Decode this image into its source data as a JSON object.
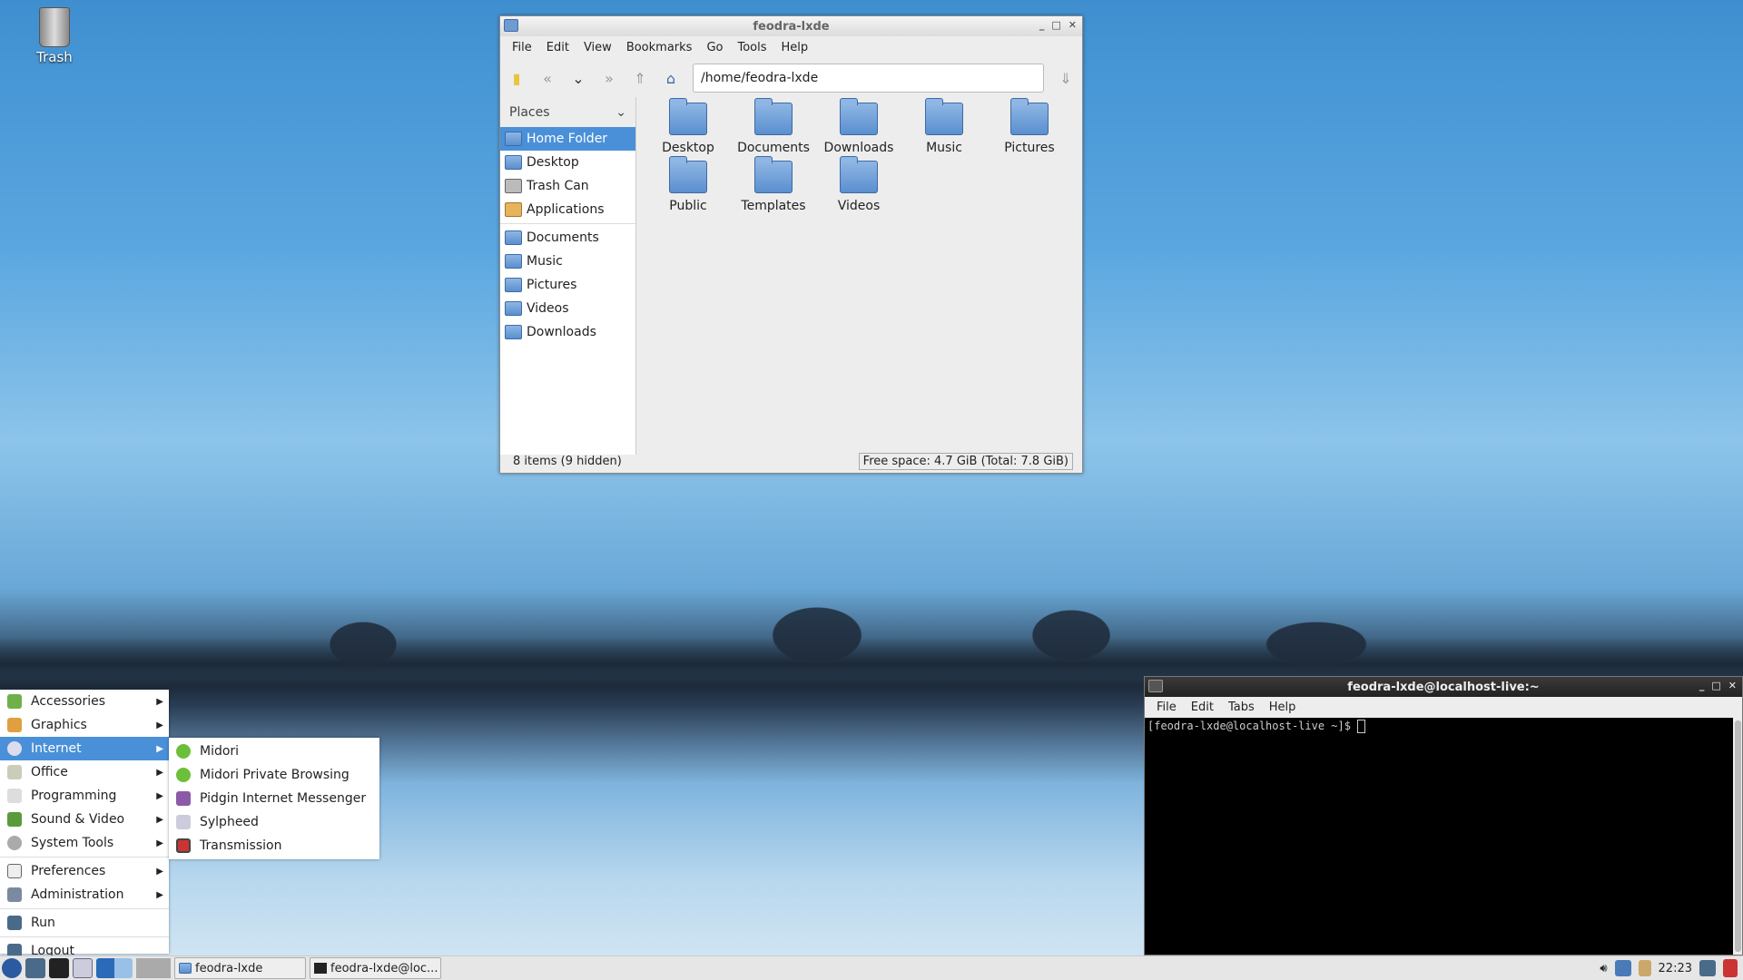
{
  "desktop": {
    "trash_label": "Trash"
  },
  "file_manager": {
    "title": "feodra-lxde",
    "menu": [
      "File",
      "Edit",
      "View",
      "Bookmarks",
      "Go",
      "Tools",
      "Help"
    ],
    "address": "/home/feodra-lxde",
    "places_label": "Places",
    "places": [
      "Home Folder",
      "Desktop",
      "Trash Can",
      "Applications"
    ],
    "bookmarks": [
      "Documents",
      "Music",
      "Pictures",
      "Videos",
      "Downloads"
    ],
    "items": [
      "Desktop",
      "Documents",
      "Downloads",
      "Music",
      "Pictures",
      "Public",
      "Templates",
      "Videos"
    ],
    "status_left": "8 items (9 hidden)",
    "status_right": "Free space: 4.7 GiB (Total: 7.8 GiB)"
  },
  "app_menu": {
    "items": [
      "Accessories",
      "Graphics",
      "Internet",
      "Office",
      "Programming",
      "Sound & Video",
      "System Tools",
      "Preferences",
      "Administration",
      "Run",
      "Logout"
    ],
    "selected": "Internet",
    "submenu": [
      "Midori",
      "Midori Private Browsing",
      "Pidgin Internet Messenger",
      "Sylpheed",
      "Transmission"
    ]
  },
  "terminal": {
    "title": "feodra-lxde@localhost-live:~",
    "menu": [
      "File",
      "Edit",
      "Tabs",
      "Help"
    ],
    "prompt": "[feodra-lxde@localhost-live ~]$ "
  },
  "taskbar": {
    "tasks": [
      "feodra-lxde",
      "feodra-lxde@loc..."
    ],
    "clock": "22:23"
  }
}
